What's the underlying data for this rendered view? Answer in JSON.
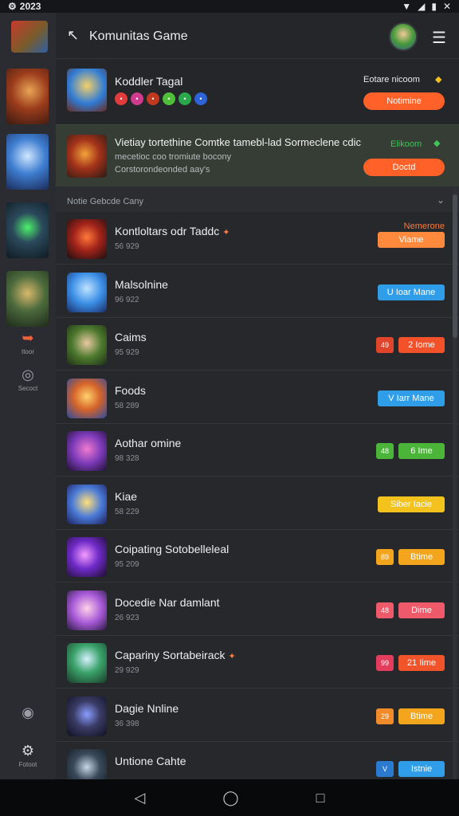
{
  "status_bar": {
    "time": "2023",
    "left_icon": "settings-gear-icon",
    "icons": [
      "wifi-icon",
      "signal-icon",
      "battery-icon",
      "notification-icon"
    ]
  },
  "header": {
    "title": "Komunitas Game",
    "back_icon": "back-arrow-icon",
    "menu_icon": "hamburger-menu-icon"
  },
  "rail": {
    "labels": {
      "share": "Itoor",
      "action": "Secoct",
      "settings": "Fotoot"
    }
  },
  "featured": [
    {
      "title": "Koddler Tagal",
      "status": "Eotare nicoom",
      "status_color": "#e7e8ea",
      "button": "Notimine",
      "emojis": [
        {
          "color": "#e23b3b",
          "icon": "angry-face-icon"
        },
        {
          "color": "#d03b8e",
          "icon": "love-face-icon"
        },
        {
          "color": "#c0391f",
          "icon": "fire-face-icon"
        },
        {
          "color": "#4fbf3a",
          "icon": "happy-face-icon"
        },
        {
          "color": "#2aa84a",
          "icon": "cool-face-icon"
        },
        {
          "color": "#2d63d6",
          "icon": "sad-face-icon"
        }
      ]
    },
    {
      "title": "Vietiay tortethine Comtke tamebl-lad Sormeclene cdic",
      "subtitle1": "mecetioc coo tromiute bocony",
      "subtitle2": "Corstorondeonded aay's",
      "status": "Elikoom",
      "status_color": "#3fc55a",
      "button": "Doctd"
    }
  ],
  "section": {
    "label": "Notie Gebcde Cany"
  },
  "list": [
    {
      "title": "Kontloltars odr Taddc",
      "sub": "56 929",
      "tag": "Nemerone",
      "button": "Viame",
      "btn_color": "#ff8a3d",
      "badge": "",
      "badge_color": "",
      "hot": true,
      "thumb": "red"
    },
    {
      "title": "Malsolnine",
      "sub": "96 922",
      "tag": "",
      "button": "U Ioar Mane",
      "btn_color": "#2f9de8",
      "badge": "",
      "badge_color": "",
      "hot": false,
      "thumb": "blue"
    },
    {
      "title": "Caims",
      "sub": "95 929",
      "tag": "",
      "button": "2 Iome",
      "btn_color": "#f2512a",
      "badge": "49",
      "badge_color": "#e0442a",
      "hot": false,
      "thumb": "green"
    },
    {
      "title": "Foods",
      "sub": "58 289",
      "tag": "",
      "button": "V Iarr Mane",
      "btn_color": "#2f9de8",
      "badge": "",
      "badge_color": "",
      "hot": false,
      "thumb": "orange"
    },
    {
      "title": "Aothar omine",
      "sub": "98 328",
      "tag": "",
      "button": "6 Ime",
      "btn_color": "#4bb53a",
      "badge": "48",
      "badge_color": "#4bb53a",
      "hot": false,
      "thumb": "purple"
    },
    {
      "title": "Kiae",
      "sub": "58 229",
      "tag": "",
      "button": "Siber Iacie",
      "btn_color": "#f3c21d",
      "badge": "",
      "badge_color": "",
      "hot": false,
      "thumb": "blue2"
    },
    {
      "title": "Coipating Sotobelleleal",
      "sub": "95 209",
      "tag": "",
      "button": "Btime",
      "btn_color": "#f3a51d",
      "badge": "89",
      "badge_color": "#f3a51d",
      "hot": false,
      "thumb": "violet"
    },
    {
      "title": "Docedie Nar damlant",
      "sub": "26 923",
      "tag": "",
      "button": "Dime",
      "btn_color": "#ee5a6a",
      "badge": "48",
      "badge_color": "#ee5a6a",
      "hot": false,
      "thumb": "pink"
    },
    {
      "title": "Capariny Sortabeirack",
      "sub": "29 929",
      "tag": "",
      "button": "21 Iime",
      "btn_color": "#f1532a",
      "badge": "99",
      "badge_color": "#e33c5c",
      "hot": true,
      "thumb": "green2"
    },
    {
      "title": "Dagie Nnline",
      "sub": "36 398",
      "tag": "",
      "button": "Btime",
      "btn_color": "#f3a51d",
      "badge": "29",
      "badge_color": "#f08a2a",
      "hot": false,
      "thumb": "dark"
    },
    {
      "title": "Untione Cahte",
      "sub": "",
      "tag": "",
      "button": "Istnie",
      "btn_color": "#2f9de8",
      "badge": "V",
      "badge_color": "#2a7bcf",
      "hot": false,
      "thumb": "teal"
    }
  ],
  "nav": {
    "back": "back-nav-icon",
    "home": "home-nav-icon",
    "recents": "recents-nav-icon"
  }
}
